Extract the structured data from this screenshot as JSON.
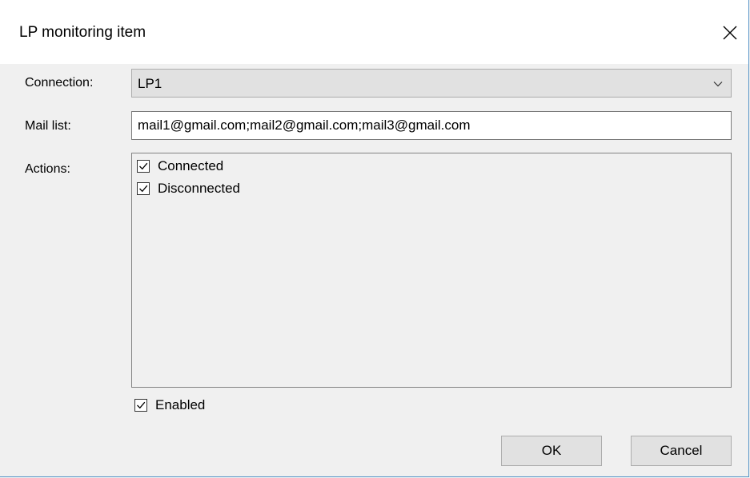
{
  "window": {
    "title": "LP monitoring item",
    "accent_color": "#5a96c8"
  },
  "form": {
    "connection": {
      "label": "Connection:",
      "value": "LP1"
    },
    "mail_list": {
      "label": "Mail list:",
      "value": "mail1@gmail.com;mail2@gmail.com;mail3@gmail.com"
    },
    "actions": {
      "label": "Actions:",
      "items": [
        {
          "label": "Connected",
          "checked": true
        },
        {
          "label": "Disconnected",
          "checked": true
        }
      ]
    },
    "enabled": {
      "label": "Enabled",
      "checked": true
    }
  },
  "buttons": {
    "ok_label": "OK",
    "cancel_label": "Cancel"
  },
  "icons": {
    "close": "close-icon",
    "dropdown": "chevron-down-icon",
    "check": "checkmark-icon"
  }
}
